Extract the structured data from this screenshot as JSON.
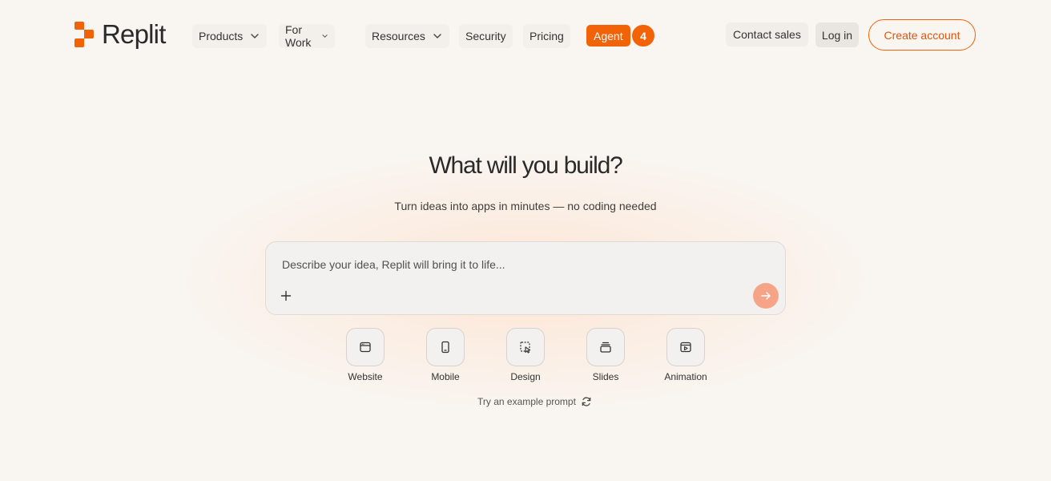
{
  "brand": {
    "name": "Replit",
    "accent": "#f26207"
  },
  "nav": {
    "items": [
      {
        "label": "Products",
        "dropdown": true
      },
      {
        "label": "For Work",
        "dropdown": true
      },
      {
        "label": "Resources",
        "dropdown": true
      },
      {
        "label": "Security",
        "dropdown": false
      },
      {
        "label": "Pricing",
        "dropdown": false
      }
    ],
    "agent_label": "Agent",
    "agent_badge": "4"
  },
  "actions": {
    "contact": "Contact sales",
    "login": "Log in",
    "create": "Create account"
  },
  "hero": {
    "title": "What will you build?",
    "subtitle": "Turn ideas into apps in minutes — no coding needed"
  },
  "prompt": {
    "placeholder": "Describe your idea, Replit will bring it to life...",
    "value": ""
  },
  "types": [
    {
      "label": "Website",
      "icon": "browser-window-icon"
    },
    {
      "label": "Mobile",
      "icon": "mobile-phone-icon"
    },
    {
      "label": "Design",
      "icon": "design-cursor-icon"
    },
    {
      "label": "Slides",
      "icon": "slides-stack-icon"
    },
    {
      "label": "Animation",
      "icon": "animation-play-icon"
    }
  ],
  "example_prompt": "Try an example prompt"
}
